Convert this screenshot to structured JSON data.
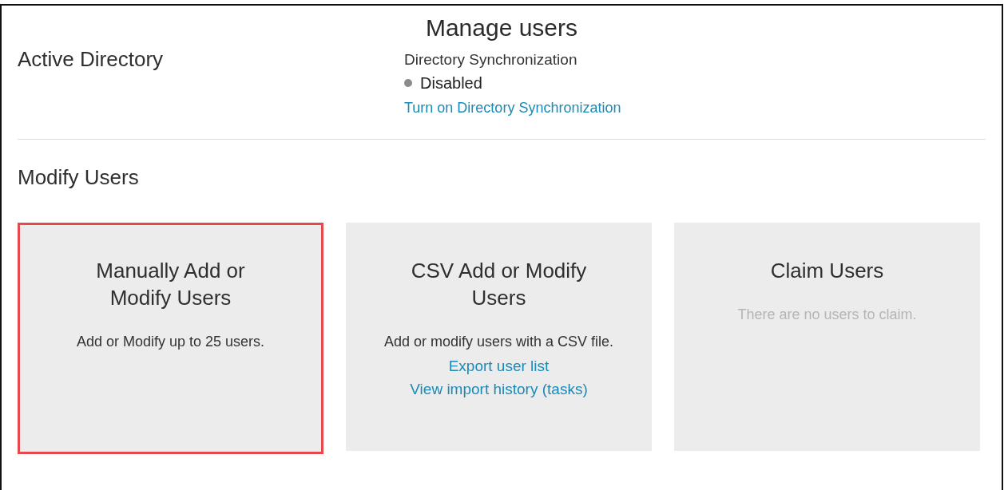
{
  "title": "Manage users",
  "active_directory": {
    "heading": "Active Directory",
    "sync_label": "Directory Synchronization",
    "status": {
      "text": "Disabled",
      "color": "#8c8c8c"
    },
    "link": "Turn on Directory Synchronization"
  },
  "modify_users": {
    "heading": "Modify Users",
    "cards": [
      {
        "title": "Manually Add or Modify Users",
        "description": "Add or Modify up to 25 users.",
        "muted": false,
        "highlighted": true
      },
      {
        "title": "CSV Add or Modify Users",
        "description": "Add or modify users with a CSV file.",
        "muted": false,
        "highlighted": false,
        "links": [
          "Export user list",
          "View import history (tasks)"
        ]
      },
      {
        "title": "Claim Users",
        "description": "There are no users to claim.",
        "muted": true,
        "highlighted": false
      }
    ]
  }
}
